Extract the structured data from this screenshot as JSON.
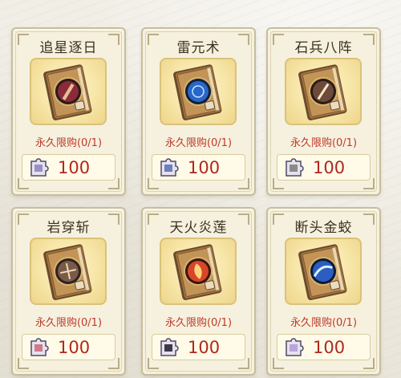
{
  "shop": {
    "items": [
      {
        "name": "追星逐日",
        "limit": "永久限购(0/1)",
        "price": "100",
        "gem_color": "#8a2a3a"
      },
      {
        "name": "雷元术",
        "limit": "永久限购(0/1)",
        "price": "100",
        "gem_color": "#2a66c8"
      },
      {
        "name": "石兵八阵",
        "limit": "永久限购(0/1)",
        "price": "100",
        "gem_color": "#6e4a3a"
      },
      {
        "name": "岩穿斩",
        "limit": "永久限购(0/1)",
        "price": "100",
        "gem_color": "#7a5a48"
      },
      {
        "name": "天火炎莲",
        "limit": "永久限购(0/1)",
        "price": "100",
        "gem_color": "#d8462a"
      },
      {
        "name": "断头金蛟",
        "limit": "永久限购(0/1)",
        "price": "100",
        "gem_color": "#2b5ec0"
      }
    ]
  },
  "colors": {
    "limit_text": "#c0392b",
    "price_text": "#b0281e",
    "card_border": "#c7bd9b"
  }
}
